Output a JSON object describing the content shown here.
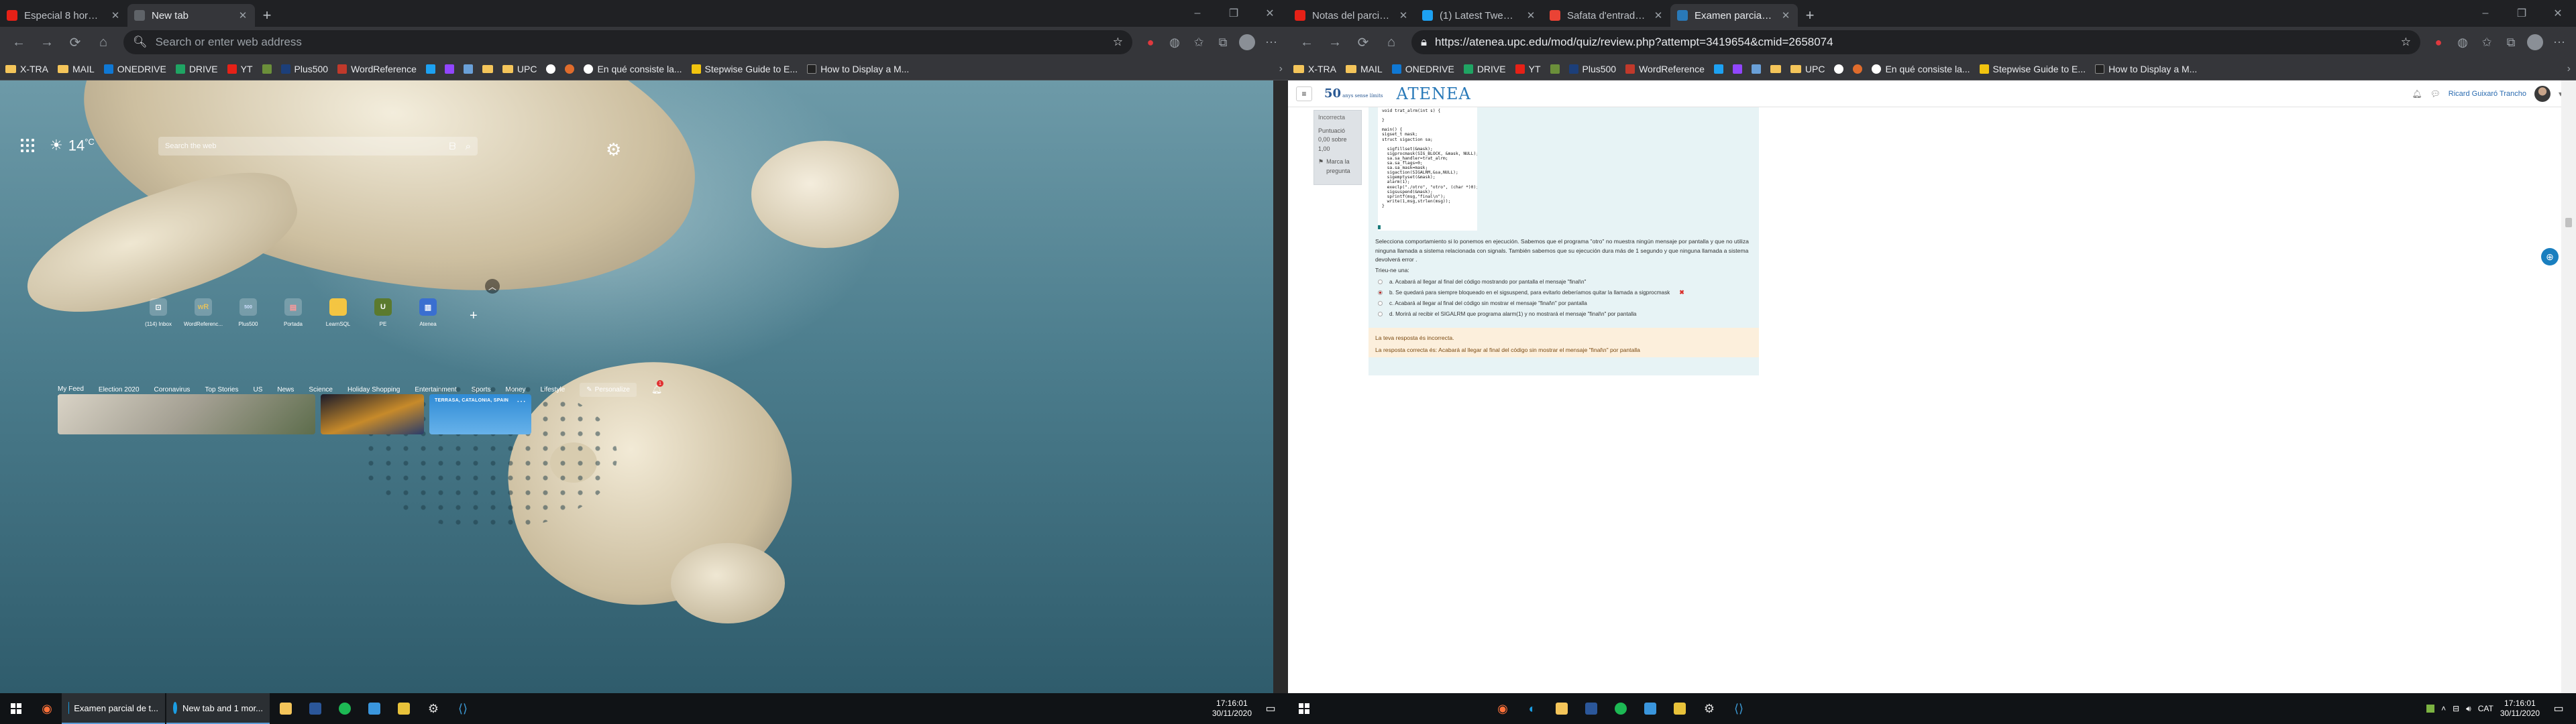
{
  "left_monitor": {
    "tabs": [
      {
        "title": "Especial 8 horas de Red Dea...",
        "color": "#e62117"
      },
      {
        "title": "New tab",
        "color": "#9aa0a6",
        "active": true
      }
    ],
    "address_placeholder": "Search or enter web address",
    "bookmarks": [
      "X-TRA",
      "MAIL",
      "ONEDRIVE",
      "DRIVE",
      "YT",
      "Plus500",
      "WordReference",
      "UPC",
      "En qué consiste la...",
      "Stepwise Guide to E...",
      "How to Display a M..."
    ],
    "weather": {
      "temp": "14",
      "unit": "°C"
    },
    "search_placeholder": "Search the web",
    "quicklinks": [
      {
        "label": "(114) Inbox",
        "glyph": "⊡"
      },
      {
        "label": "WordReferenc...",
        "glyph": "wR"
      },
      {
        "label": "Plus500",
        "glyph": "500"
      },
      {
        "label": "Portada",
        "glyph": "▤"
      },
      {
        "label": "LearnSQL",
        "glyph": "▦"
      },
      {
        "label": "PE",
        "glyph": "U"
      },
      {
        "label": "Atenea",
        "glyph": "▥"
      }
    ],
    "feed_nav": [
      "My Feed",
      "Election 2020",
      "Coronavirus",
      "Top Stories",
      "US",
      "News",
      "Science",
      "Holiday Shopping",
      "Entertainment",
      "Sports",
      "Money",
      "Lifestyle"
    ],
    "personalize_label": "Personalize",
    "notification_count": "1",
    "weather_card_label": "TERRASA, CATALONIA, SPAIN"
  },
  "right_monitor": {
    "tabs": [
      {
        "title": "Notas del parcial de teoría - Ra...",
        "color": "#e62117"
      },
      {
        "title": "(1) Latest Tweets / Twitter",
        "color": "#1da1f2"
      },
      {
        "title": "Safata d'entrada (11) - ricard.gu...",
        "color": "#ea4335"
      },
      {
        "title": "Examen parcial de teoría",
        "color": "#2979b8",
        "active": true
      }
    ],
    "url": "https://atenea.upc.edu/mod/quiz/review.php?attempt=3419654&cmid=2658074",
    "bookmarks": [
      "X-TRA",
      "MAIL",
      "ONEDRIVE",
      "DRIVE",
      "YT",
      "Plus500",
      "WordReference",
      "UPC",
      "En qué consiste la...",
      "Stepwise Guide to E...",
      "How to Display a M..."
    ],
    "logo_50": "50",
    "logo_50_sub": "anys sense límits",
    "logo_atenea": "ATENEA",
    "user_name": "Ricard Guixaró Trancho",
    "question_info": {
      "status": "Incorrecta",
      "score": "Puntuació 0,00 sobre 1,00",
      "flag": "Marca la pregunta"
    },
    "code": "void trat_alrm(int s) {\n\n}\n\nmain() {\nsigset_t mask;\nstruct sigaction sa;\n\n  sigfillset(&mask);\n  sigprocmask(SIG_BLOCK, &mask, NULL);\n  sa.sa_handler=trat_alrm;\n  sa.sa_flags=0;\n  sa.sa_mask=mask;\n  sigaction(SIGALRM,&sa,NULL);\n  sigemptyset(&mask);\n  alarm(1);\n  execlp(\"./otro\", \"otro\", (char *)0);\n  sigsuspend(&mask);\n  sprintf(msg,\"final\\n\");\n  write(1,msg,strlen(msg));\n}",
    "question_text": "Selecciona  comportamiento si lo ponemos en ejecución. Sabemos que el programa \"otro\" no muestra ningún mensaje por pantalla y que no utiliza ninguna llamada a sistema relacionada con signals. También sabemos que su ejecución dura más de 1 segundo y que ninguna llamada a sistema devolverá error .",
    "answer_prompt": "Trieu-ne una:",
    "options": [
      {
        "text": "a. Acabará al llegar al final del código mostrando por pantalla el mensaje \"final\\n\"",
        "selected": false
      },
      {
        "text": "b. Se quedará para siempre bloqueado en el sigsuspend, para evitarlo deberíamos quitar la llamada a sigprocmask",
        "selected": true,
        "wrong": true
      },
      {
        "text": "c. Acabará al llegar al final del código sin mostrar el mensaje \"final\\n\" por pantalla",
        "selected": false
      },
      {
        "text": "d. Morirá al recibir el SIGALRM que programa alarm(1) y no mostrará el mensaje \"final\\n\" por pantalla",
        "selected": false
      }
    ],
    "feedback_wrong": "La teva resposta és incorrecta.",
    "feedback_correct": "La resposta correcta és: Acabará al llegar al final del código sin mostrar el mensaje \"final\\n\" por pantalla"
  },
  "taskbar_left": {
    "apps": [
      {
        "label": "Examen parcial de t...",
        "color": "#1b9de2"
      },
      {
        "label": "New tab and 1 mor...",
        "color": "#1b9de2"
      }
    ],
    "time": "17:16:01",
    "date": "30/11/2020"
  },
  "taskbar_right": {
    "lang": "CAT",
    "time": "17:16:01",
    "date": "30/11/2020"
  },
  "colors": {
    "accent": "#2979b8",
    "dark_chrome": "#35363a",
    "question_bg": "#e7f3f5",
    "feedback_bg": "#fcefdc",
    "wrong": "#d9302c"
  }
}
